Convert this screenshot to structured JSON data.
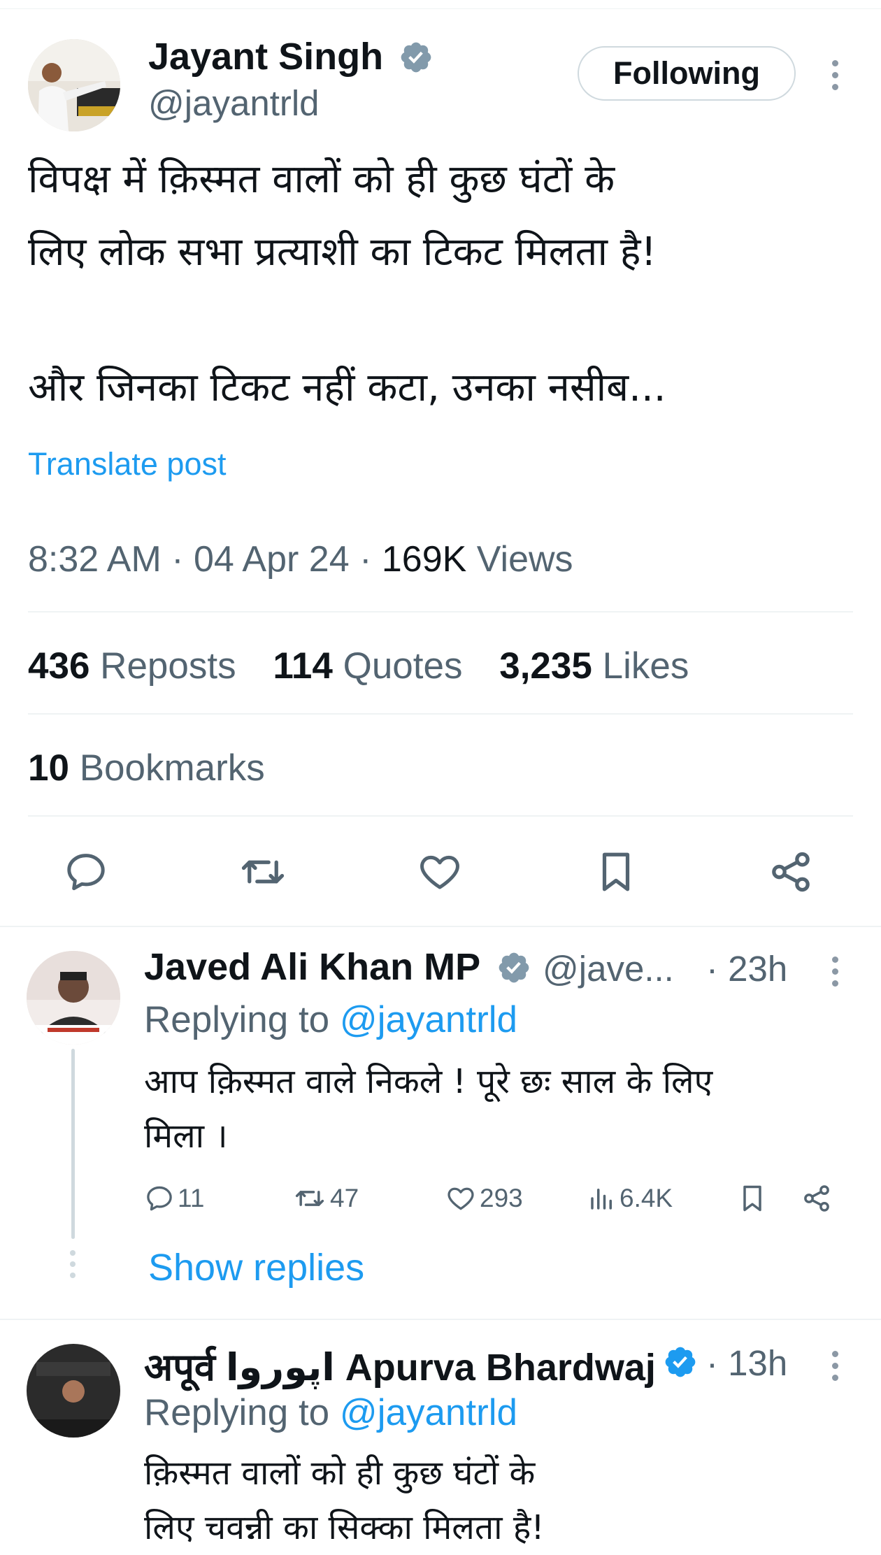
{
  "tweet": {
    "author_name": "Jayant Singh",
    "author_handle": "@jayantrld",
    "follow_label": "Following",
    "text_line1": "विपक्ष में क़िस्मत वालों को ही कुछ घंटों के",
    "text_line2": "लिए लोक सभा प्रत्याशी का टिकट मिलता है!",
    "text_line3": "और जिनका टिकट नहीं कटा, उनका नसीब...",
    "translate_label": "Translate post",
    "time": "8:32 AM",
    "date": "04 Apr 24",
    "views_count": "169K",
    "views_label": "Views",
    "reposts_count": "436",
    "reposts_label": "Reposts",
    "quotes_count": "114",
    "quotes_label": "Quotes",
    "likes_count": "3,235",
    "likes_label": "Likes",
    "bookmarks_count": "10",
    "bookmarks_label": "Bookmarks"
  },
  "replies": [
    {
      "author_name": "Javed Ali Khan MP",
      "author_handle": "@jave...",
      "time": "23h",
      "replying_prefix": "Replying to",
      "replying_handle": "@jayantrld",
      "text_line1": "आप क़िस्मत वाले निकले ! पूरे छः साल के लिए",
      "text_line2": "मिला ।",
      "replies_count": "11",
      "reposts_count": "47",
      "likes_count": "293",
      "views_count": "6.4K",
      "show_replies_label": "Show replies"
    },
    {
      "author_name": "अपूर्व اپوروا Apurva Bhardwaj",
      "time": "13h",
      "replying_prefix": "Replying to",
      "replying_handle": "@jayantrld",
      "text_line1": "क़िस्मत वालों को ही कुछ घंटों के",
      "text_line2": "लिए चवन्नी का सिक्का मिलता है!"
    }
  ],
  "colors": {
    "accent": "#1d9bf0",
    "verified_gray": "#829aab",
    "verified_blue": "#1d9bf0",
    "secondary_text": "#536471"
  },
  "icons": [
    "verified-badge-icon",
    "more-icon",
    "reply-icon",
    "repost-icon",
    "like-icon",
    "bookmark-icon",
    "share-icon",
    "views-icon"
  ]
}
